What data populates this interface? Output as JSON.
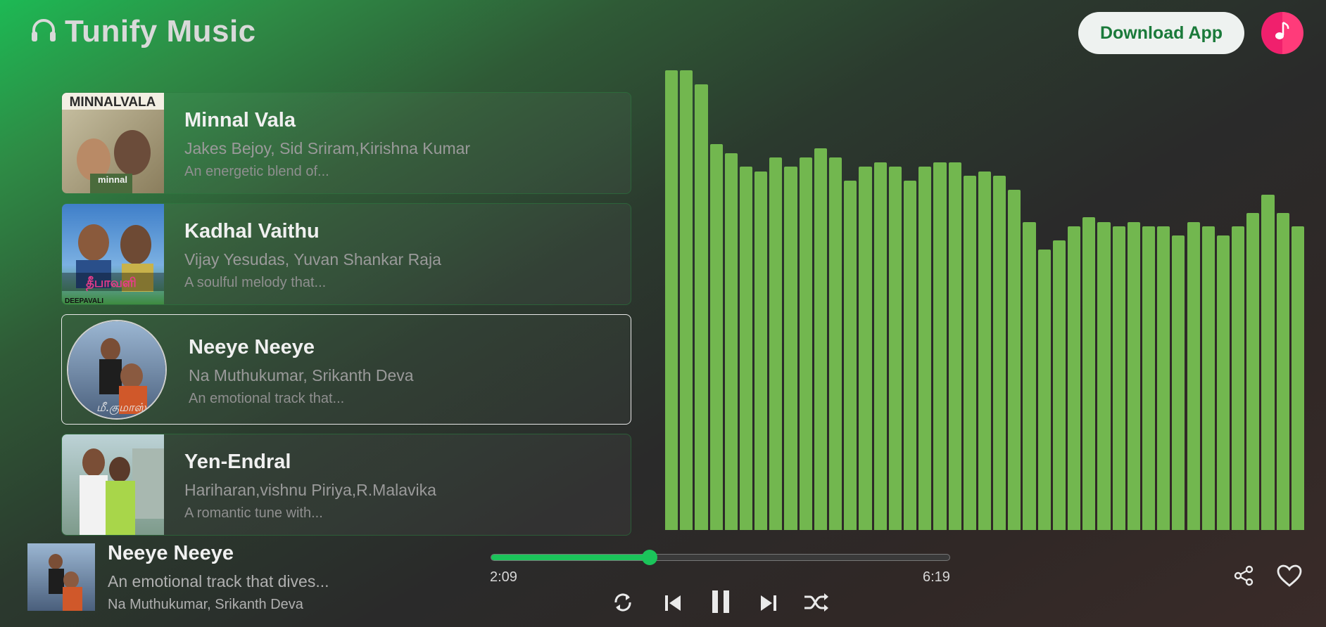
{
  "header": {
    "brand_icon": "headphones-icon",
    "brand_title": "Tunify Music",
    "download_label": "Download App",
    "avatar_icon": "music-note-icon"
  },
  "songs": [
    {
      "title": "Minnal Vala",
      "artists": "Jakes Bejoy, Sid Sriram,Kirishna Kumar",
      "desc": "An energetic blend of...",
      "cover_text": "MINNALVALA",
      "active": false
    },
    {
      "title": "Kadhal Vaithu",
      "artists": "Vijay Yesudas, Yuvan Shankar Raja",
      "desc": "A soulful melody that...",
      "cover_text": "DEEPAVALI",
      "active": false
    },
    {
      "title": "Neeye Neeye",
      "artists": "Na Muthukumar, Srikanth Deva",
      "desc": "An emotional track that...",
      "cover_text": "",
      "active": true
    },
    {
      "title": "Yen-Endral",
      "artists": "Hariharan,vishnu Piriya,R.Malavika",
      "desc": "A romantic tune with...",
      "cover_text": "",
      "active": false
    }
  ],
  "visualizer": {
    "color": "#72b74f",
    "levels": [
      1.0,
      1.0,
      0.97,
      0.84,
      0.82,
      0.79,
      0.78,
      0.81,
      0.79,
      0.81,
      0.83,
      0.81,
      0.76,
      0.79,
      0.8,
      0.79,
      0.76,
      0.79,
      0.8,
      0.8,
      0.77,
      0.78,
      0.77,
      0.74,
      0.67,
      0.61,
      0.63,
      0.66,
      0.68,
      0.67,
      0.66,
      0.67,
      0.66,
      0.66,
      0.64,
      0.67,
      0.66,
      0.64,
      0.66,
      0.69,
      0.73,
      0.69,
      0.66
    ]
  },
  "now_playing": {
    "title": "Neeye Neeye",
    "desc": "An emotional track that dives...",
    "artists": "Na Muthukumar, Srikanth Deva",
    "elapsed": "2:09",
    "duration": "6:19",
    "progress": 0.345
  },
  "controls": {
    "repeat_icon": "repeat-icon",
    "prev_icon": "skip-previous-icon",
    "pause_icon": "pause-icon",
    "next_icon": "skip-next-icon",
    "shuffle_icon": "shuffle-icon",
    "share_icon": "share-icon",
    "like_icon": "heart-icon"
  },
  "colors": {
    "accent": "#1bc45a",
    "visualizer": "#72b74f",
    "download_text": "#1a7a3a",
    "avatar": "#f0206d"
  }
}
